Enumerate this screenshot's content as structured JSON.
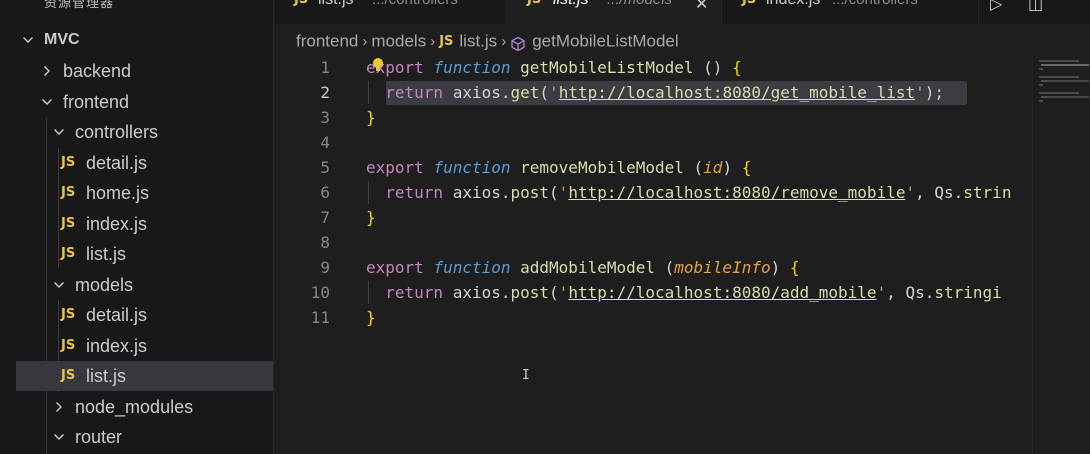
{
  "sidebar": {
    "title": "资源管理器",
    "more_label": "···",
    "root": "MVC",
    "items": [
      {
        "label": "backend",
        "kind": "folder",
        "expanded": false,
        "depth": 1
      },
      {
        "label": "frontend",
        "kind": "folder",
        "expanded": true,
        "depth": 1
      },
      {
        "label": "controllers",
        "kind": "folder",
        "expanded": true,
        "depth": 2
      },
      {
        "label": "detail.js",
        "kind": "file",
        "depth": 3
      },
      {
        "label": "home.js",
        "kind": "file",
        "depth": 3
      },
      {
        "label": "index.js",
        "kind": "file",
        "depth": 3
      },
      {
        "label": "list.js",
        "kind": "file",
        "depth": 3
      },
      {
        "label": "models",
        "kind": "folder",
        "expanded": true,
        "depth": 2
      },
      {
        "label": "detail.js",
        "kind": "file",
        "depth": 3
      },
      {
        "label": "index.js",
        "kind": "file",
        "depth": 3
      },
      {
        "label": "list.js",
        "kind": "file",
        "depth": 3,
        "selected": true
      },
      {
        "label": "node_modules",
        "kind": "folder",
        "expanded": false,
        "depth": 2
      },
      {
        "label": "router",
        "kind": "folder",
        "expanded": true,
        "depth": 2
      }
    ],
    "js_badge": "JS"
  },
  "tabs": [
    {
      "badge": "JS",
      "name": "list.js",
      "path": ".../controllers",
      "active": false
    },
    {
      "badge": "JS",
      "name": "list.js",
      "path": ".../models",
      "active": true,
      "close": "✕"
    },
    {
      "badge": "JS",
      "name": "index.js",
      "path": ".../controllers",
      "active": false
    }
  ],
  "actions": {
    "run": "▷",
    "split": "◫"
  },
  "breadcrumb": {
    "parts": [
      "frontend",
      "models"
    ],
    "file_badge": "JS",
    "file": "list.js",
    "symbol": "getMobileListModel",
    "separator": "›"
  },
  "editor": {
    "line_numbers": [
      "1",
      "2",
      "3",
      "4",
      "5",
      "6",
      "7",
      "8",
      "9",
      "10",
      "11"
    ],
    "active_line": 2,
    "lines": [
      [
        {
          "t": "export",
          "c": "ctl-ex"
        },
        {
          "t": " "
        },
        {
          "t": "function",
          "c": "kw it"
        },
        {
          "t": " "
        },
        {
          "t": "getMobileListModel",
          "c": "fn"
        },
        {
          "t": " () ",
          "c": "pun"
        },
        {
          "t": "{",
          "c": "brk"
        }
      ],
      [
        {
          "t": "  "
        },
        {
          "t": "return",
          "c": "ctl"
        },
        {
          "t": " axios.",
          "c": "pun"
        },
        {
          "t": "get",
          "c": "fn"
        },
        {
          "t": "(",
          "c": "pun"
        },
        {
          "t": "'",
          "c": "str"
        },
        {
          "t": "http://localhost:8080/get_mobile_list",
          "c": "url"
        },
        {
          "t": "'",
          "c": "str"
        },
        {
          "t": ");",
          "c": "pun"
        }
      ],
      [
        {
          "t": "}",
          "c": "brk"
        }
      ],
      [],
      [
        {
          "t": "export",
          "c": "ctl"
        },
        {
          "t": " "
        },
        {
          "t": "function",
          "c": "kw it"
        },
        {
          "t": " "
        },
        {
          "t": "removeMobileModel",
          "c": "fn"
        },
        {
          "t": " (",
          "c": "pun"
        },
        {
          "t": "id",
          "c": "par"
        },
        {
          "t": ") ",
          "c": "pun"
        },
        {
          "t": "{",
          "c": "brk"
        }
      ],
      [
        {
          "t": "  "
        },
        {
          "t": "return",
          "c": "ctl"
        },
        {
          "t": " axios.",
          "c": "pun"
        },
        {
          "t": "post",
          "c": "fn"
        },
        {
          "t": "(",
          "c": "pun"
        },
        {
          "t": "'",
          "c": "str"
        },
        {
          "t": "http://localhost:8080/remove_mobile",
          "c": "url"
        },
        {
          "t": "'",
          "c": "str"
        },
        {
          "t": ", Qs.",
          "c": "pun"
        },
        {
          "t": "strin",
          "c": "fn"
        }
      ],
      [
        {
          "t": "}",
          "c": "brk"
        }
      ],
      [],
      [
        {
          "t": "export",
          "c": "ctl"
        },
        {
          "t": " "
        },
        {
          "t": "function",
          "c": "kw it"
        },
        {
          "t": " "
        },
        {
          "t": "addMobileModel",
          "c": "fn"
        },
        {
          "t": " (",
          "c": "pun"
        },
        {
          "t": "mobileInfo",
          "c": "par"
        },
        {
          "t": ") ",
          "c": "pun"
        },
        {
          "t": "{",
          "c": "brk"
        }
      ],
      [
        {
          "t": "  "
        },
        {
          "t": "return",
          "c": "ctl"
        },
        {
          "t": " axios.",
          "c": "pun"
        },
        {
          "t": "post",
          "c": "fn"
        },
        {
          "t": "(",
          "c": "pun"
        },
        {
          "t": "'",
          "c": "str"
        },
        {
          "t": "http://localhost:8080/add_mobile",
          "c": "url"
        },
        {
          "t": "'",
          "c": "str"
        },
        {
          "t": ", Qs.",
          "c": "pun"
        },
        {
          "t": "stringi",
          "c": "fn"
        }
      ],
      [
        {
          "t": "}",
          "c": "brk"
        }
      ]
    ]
  },
  "colors": {
    "background": "#1e1e1e",
    "sidebar": "#181818",
    "selection": "#37373d",
    "js_badge": "#e8c547"
  }
}
